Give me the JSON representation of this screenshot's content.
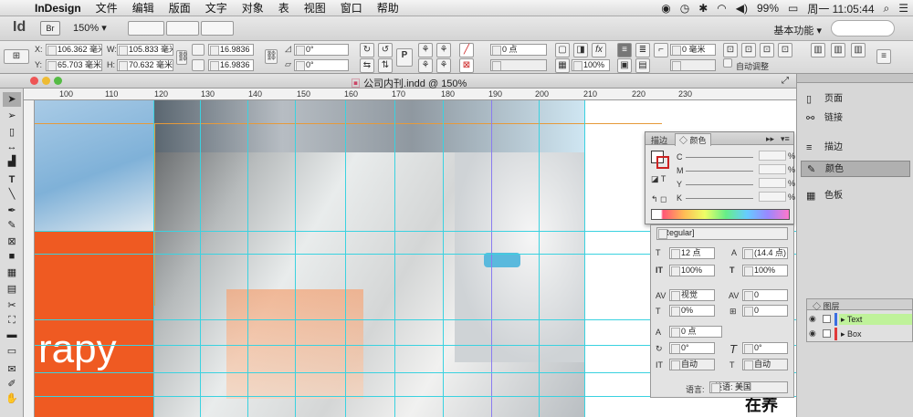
{
  "menubar": {
    "app": "InDesign",
    "items": [
      "文件",
      "编辑",
      "版面",
      "文字",
      "对象",
      "表",
      "视图",
      "窗口",
      "帮助"
    ],
    "battery": "99%",
    "clock": "周一 11:05:44"
  },
  "appbar": {
    "logo": "Id",
    "br": "Br",
    "zoom": "150%",
    "workspace": "基本功能"
  },
  "control": {
    "x_label": "X:",
    "x_value": "106.362 毫米",
    "y_label": "Y:",
    "y_value": "65.703 毫米",
    "w_label": "W:",
    "w_value": "105.833 毫米",
    "h_label": "H:",
    "h_value": "70.632 毫米",
    "scale_x": "16.9836",
    "scale_y": "16.9836",
    "angle": "0°",
    "shear": "0°",
    "stroke_weight": "0 点",
    "opacity": "100%",
    "offset": "0 毫米",
    "auto_fit": "自动调整"
  },
  "document": {
    "tab_title": "公司内刊.indd @ 150%",
    "ruler_ticks": [
      "100",
      "110",
      "120",
      "130",
      "140",
      "150",
      "160",
      "170",
      "180",
      "190",
      "200",
      "210",
      "220",
      "230"
    ],
    "page_text": "rapy",
    "bottom_text": "在养"
  },
  "color_panel": {
    "tab_stroke": "描边",
    "tab_color": "颜色",
    "channels": [
      "C",
      "M",
      "Y",
      "K"
    ],
    "unit": "%"
  },
  "char_panel": {
    "font_style": "[Regular]",
    "size": "12 点",
    "leading": "(14.4 点)",
    "vscale": "100%",
    "hscale": "100%",
    "kerning": "视觉",
    "tracking": "0",
    "tsume": "0%",
    "aki": "0",
    "baseline": "0 点",
    "rotate": "0°",
    "skew": "0°",
    "auto1": "自动",
    "auto2": "自动",
    "language_label": "语言:",
    "language": "英语: 美国"
  },
  "right_panel": {
    "items": [
      "页面",
      "链接",
      "描边",
      "颜色",
      "色板"
    ]
  },
  "layers": {
    "title": "图层",
    "rows": [
      "Text",
      "Box"
    ]
  },
  "colors": {
    "orange": "#ef5a22",
    "guide": "#3ad2e0",
    "layer_highlight": "#bff29a"
  }
}
